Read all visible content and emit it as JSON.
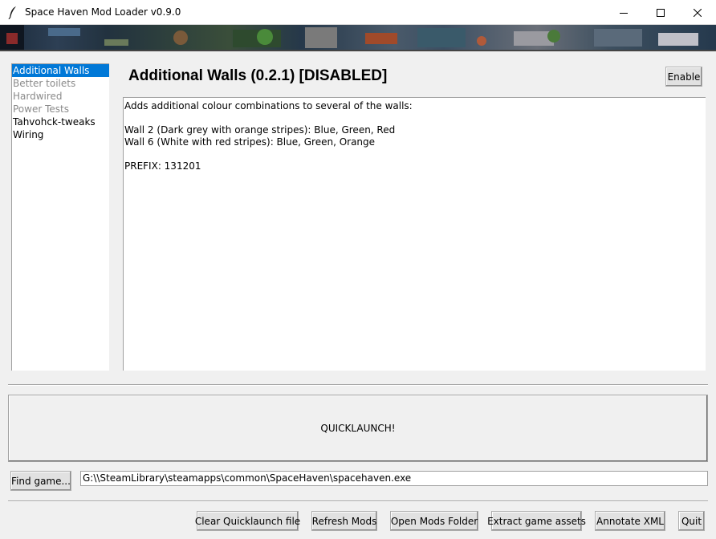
{
  "window": {
    "title": "Space Haven Mod Loader v0.9.0",
    "controls": [
      "minimize-icon",
      "maximize-icon",
      "close-icon"
    ]
  },
  "mods": [
    {
      "name": "Additional Walls",
      "state": "selected"
    },
    {
      "name": "Better toilets",
      "state": "disabled"
    },
    {
      "name": "Hardwired",
      "state": "disabled"
    },
    {
      "name": "Power Tests",
      "state": "disabled"
    },
    {
      "name": "Tahvohck-tweaks",
      "state": "enabled"
    },
    {
      "name": "Wiring",
      "state": "enabled"
    }
  ],
  "detail": {
    "title": "Additional Walls (0.2.1) [DISABLED]",
    "enable_label": "Enable",
    "description_lines": [
      "Adds additional colour combinations to several of the walls:",
      "",
      "Wall 2 (Dark grey with orange stripes): Blue, Green, Red",
      "Wall 6 (White with red stripes): Blue, Green, Orange",
      "",
      "PREFIX: 131201"
    ]
  },
  "quicklaunch_label": "QUICKLAUNCH!",
  "game_path": {
    "find_label": "Find game...",
    "value": "G:\\\\SteamLibrary\\steamapps\\common\\SpaceHaven\\spacehaven.exe"
  },
  "actions": {
    "clear_quicklaunch": "Clear Quicklaunch file",
    "refresh_mods": "Refresh Mods",
    "open_mods_folder": "Open Mods Folder",
    "extract_assets": "Extract game assets",
    "annotate_xml": "Annotate XML",
    "quit": "Quit"
  },
  "colors": {
    "selection": "#0078d7",
    "disabled_text": "#8a8a8a"
  }
}
